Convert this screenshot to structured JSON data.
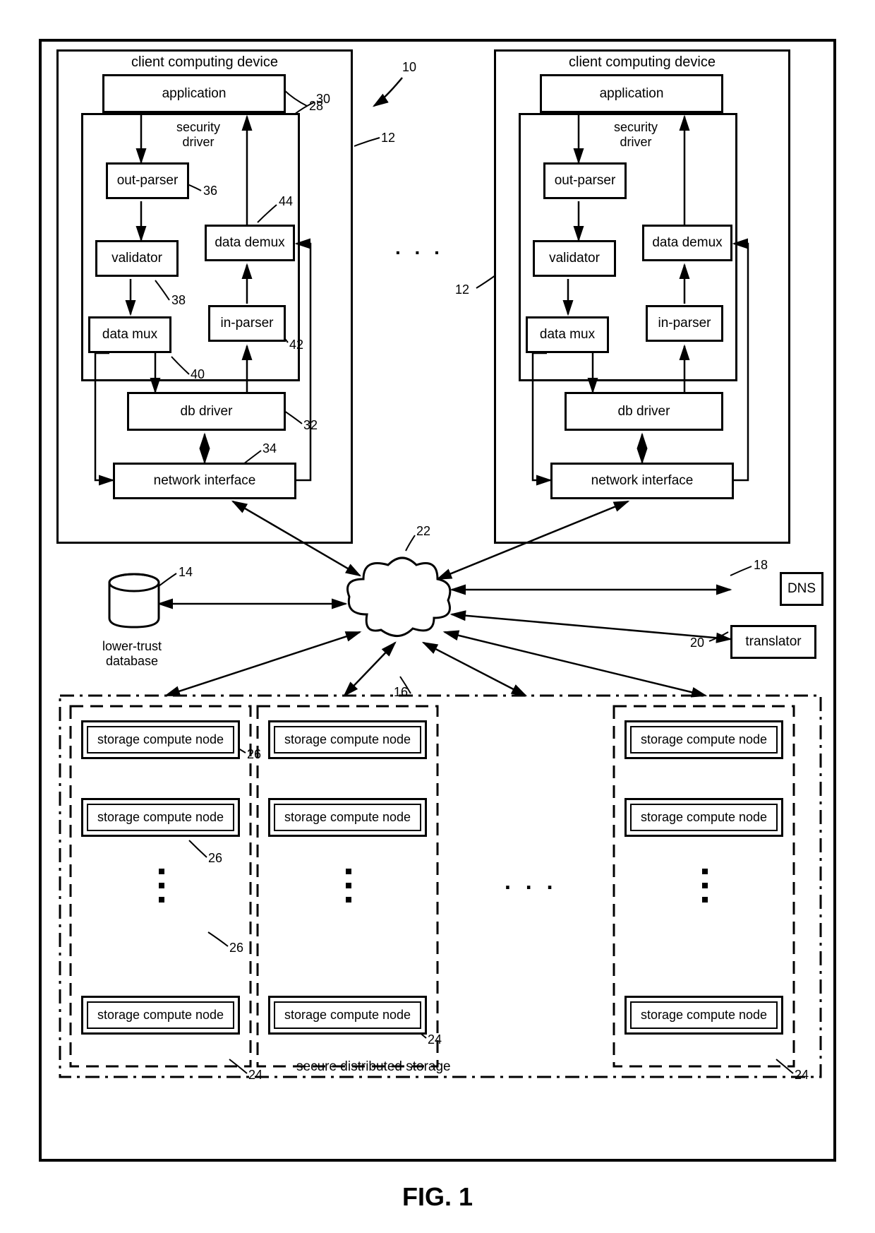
{
  "figure": "FIG. 1",
  "client": {
    "title": "client computing device",
    "application": "application",
    "security_driver_label": "security\ndriver",
    "out_parser": "out-parser",
    "validator": "validator",
    "data_mux": "data mux",
    "data_demux": "data demux",
    "in_parser": "in-parser",
    "db_driver": "db driver",
    "network_interface": "network interface"
  },
  "refs": {
    "r10": "10",
    "r12": "12",
    "r14": "14",
    "r16": "16",
    "r18": "18",
    "r20": "20",
    "r22": "22",
    "r24": "24",
    "r26": "26",
    "r28": "28",
    "r30": "30",
    "r32": "32",
    "r34": "34",
    "r36": "36",
    "r38": "38",
    "r40": "40",
    "r42": "42",
    "r44": "44"
  },
  "lower_trust_db": "lower-trust\ndatabase",
  "dns": "DNS",
  "translator": "translator",
  "storage_node": "storage compute node",
  "secure_distributed_storage": "secure distributed storage",
  "ellipsis": ". . ."
}
